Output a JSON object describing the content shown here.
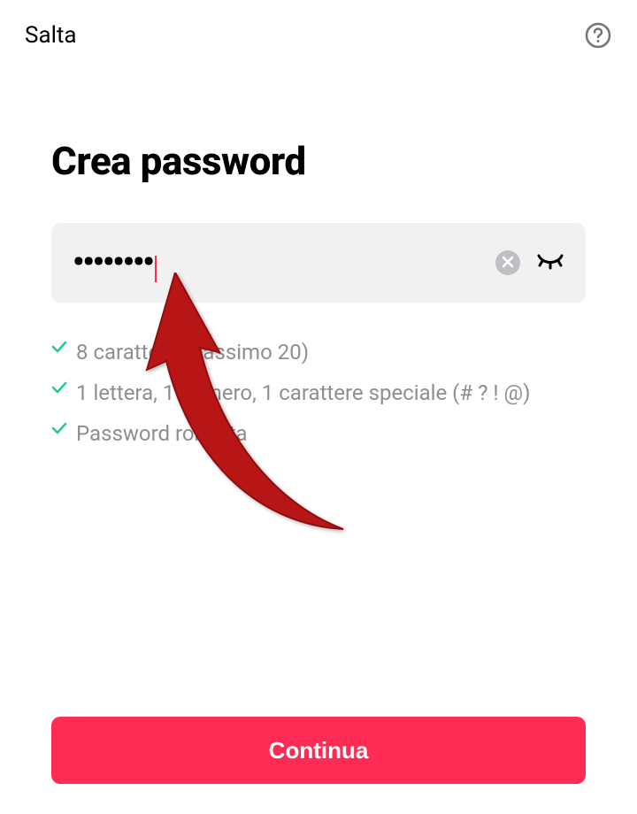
{
  "header": {
    "skip_label": "Salta"
  },
  "title": "Crea password",
  "password": {
    "masked_value": "••••••••"
  },
  "requirements": {
    "items": [
      {
        "text": "8 caratteri (massimo 20)"
      },
      {
        "text": "1 lettera, 1 numero, 1 carattere speciale (# ? ! @)"
      },
      {
        "text": "Password robusta"
      }
    ]
  },
  "continue_label": "Continua",
  "colors": {
    "accent": "#fe2c55",
    "check": "#20c997"
  }
}
